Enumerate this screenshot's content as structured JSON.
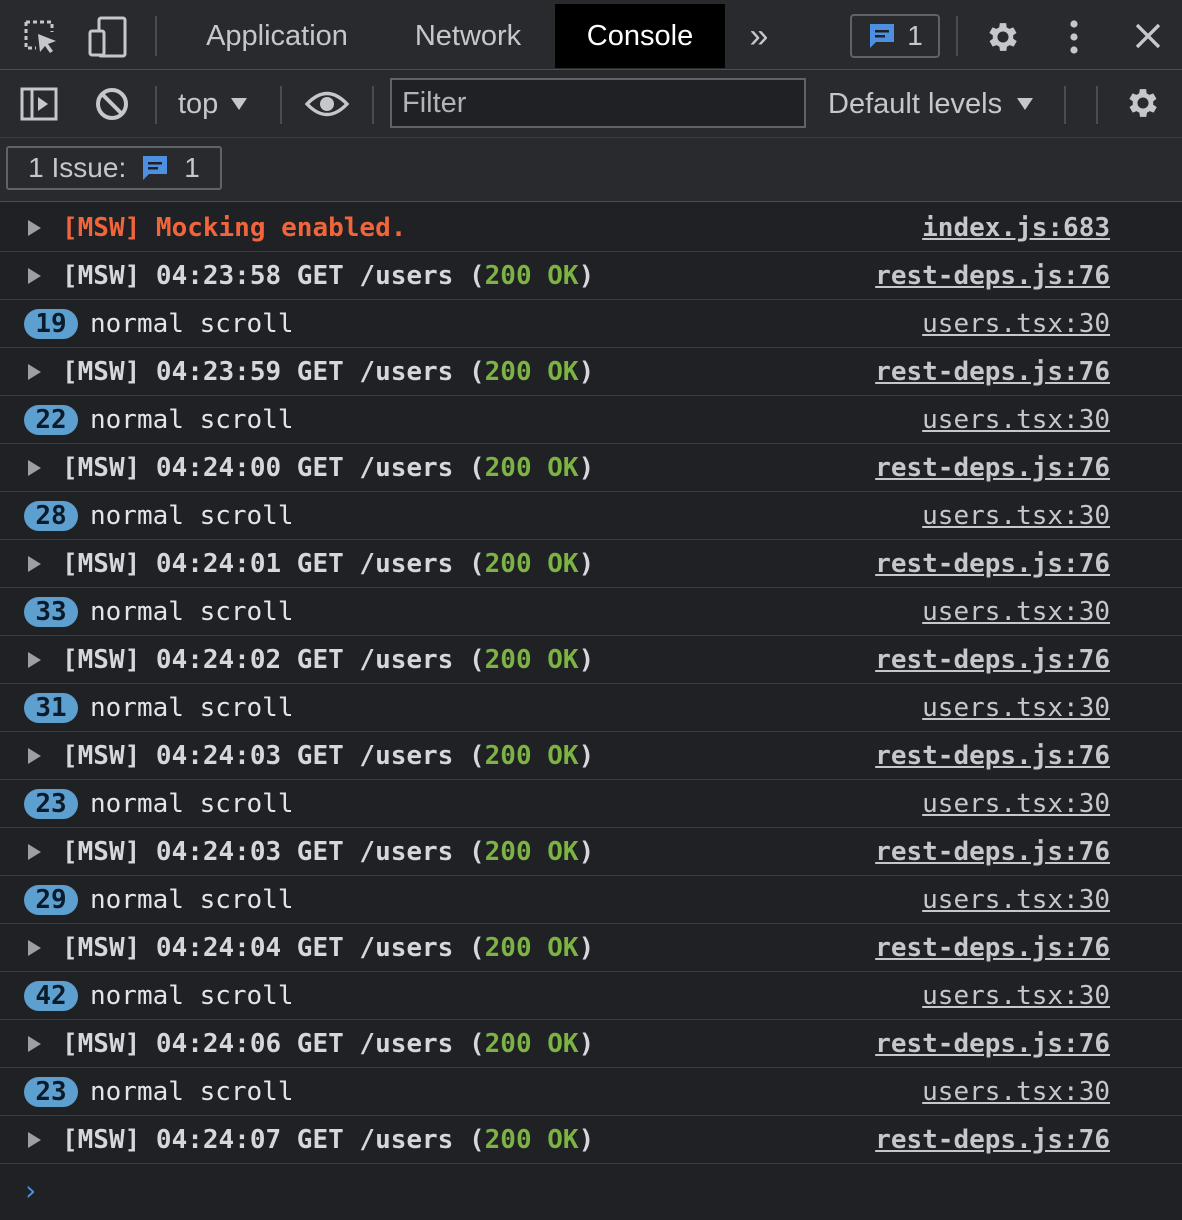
{
  "tabs": [
    {
      "label": "Application",
      "active": false
    },
    {
      "label": "Network",
      "active": false
    },
    {
      "label": "Console",
      "active": true
    }
  ],
  "tabs_overflow": "»",
  "issues_count": "1",
  "toolbar": {
    "context": "top",
    "filter_placeholder": "Filter",
    "levels": "Default levels"
  },
  "issue_bar": {
    "label": "1 Issue:",
    "count": "1"
  },
  "colors": {
    "accent_blue": "#4d8fe0",
    "error_orange": "#f2653a",
    "ok_green": "#7cb342",
    "badge_blue": "#5d9fcf"
  },
  "icons": [
    "inspect-icon",
    "device-toolbar-icon",
    "issues-message-icon",
    "settings-gear-icon",
    "more-vert-icon",
    "close-icon",
    "sidebar-toggle-icon",
    "clear-console-icon",
    "eye-icon",
    "console-settings-icon"
  ],
  "rows": [
    {
      "kind": "msw",
      "err": true,
      "text": "[MSW] Mocking enabled.",
      "src": "index.js:683"
    },
    {
      "kind": "msw",
      "prefix": "[MSW] 04:23:58 GET /users (",
      "status": "200 OK",
      "suffix": ")",
      "src": "rest-deps.js:76"
    },
    {
      "kind": "log",
      "count": "19",
      "text": "normal scroll",
      "src": "users.tsx:30"
    },
    {
      "kind": "msw",
      "prefix": "[MSW] 04:23:59 GET /users (",
      "status": "200 OK",
      "suffix": ")",
      "src": "rest-deps.js:76"
    },
    {
      "kind": "log",
      "count": "22",
      "text": "normal scroll",
      "src": "users.tsx:30"
    },
    {
      "kind": "msw",
      "prefix": "[MSW] 04:24:00 GET /users (",
      "status": "200 OK",
      "suffix": ")",
      "src": "rest-deps.js:76"
    },
    {
      "kind": "log",
      "count": "28",
      "text": "normal scroll",
      "src": "users.tsx:30"
    },
    {
      "kind": "msw",
      "prefix": "[MSW] 04:24:01 GET /users (",
      "status": "200 OK",
      "suffix": ")",
      "src": "rest-deps.js:76"
    },
    {
      "kind": "log",
      "count": "33",
      "text": "normal scroll",
      "src": "users.tsx:30"
    },
    {
      "kind": "msw",
      "prefix": "[MSW] 04:24:02 GET /users (",
      "status": "200 OK",
      "suffix": ")",
      "src": "rest-deps.js:76"
    },
    {
      "kind": "log",
      "count": "31",
      "text": "normal scroll",
      "src": "users.tsx:30"
    },
    {
      "kind": "msw",
      "prefix": "[MSW] 04:24:03 GET /users (",
      "status": "200 OK",
      "suffix": ")",
      "src": "rest-deps.js:76"
    },
    {
      "kind": "log",
      "count": "23",
      "text": "normal scroll",
      "src": "users.tsx:30"
    },
    {
      "kind": "msw",
      "prefix": "[MSW] 04:24:03 GET /users (",
      "status": "200 OK",
      "suffix": ")",
      "src": "rest-deps.js:76"
    },
    {
      "kind": "log",
      "count": "29",
      "text": "normal scroll",
      "src": "users.tsx:30"
    },
    {
      "kind": "msw",
      "prefix": "[MSW] 04:24:04 GET /users (",
      "status": "200 OK",
      "suffix": ")",
      "src": "rest-deps.js:76"
    },
    {
      "kind": "log",
      "count": "42",
      "text": "normal scroll",
      "src": "users.tsx:30"
    },
    {
      "kind": "msw",
      "prefix": "[MSW] 04:24:06 GET /users (",
      "status": "200 OK",
      "suffix": ")",
      "src": "rest-deps.js:76"
    },
    {
      "kind": "log",
      "count": "23",
      "text": "normal scroll",
      "src": "users.tsx:30"
    },
    {
      "kind": "msw",
      "prefix": "[MSW] 04:24:07 GET /users (",
      "status": "200 OK",
      "suffix": ")",
      "src": "rest-deps.js:76"
    }
  ],
  "prompt": "›"
}
